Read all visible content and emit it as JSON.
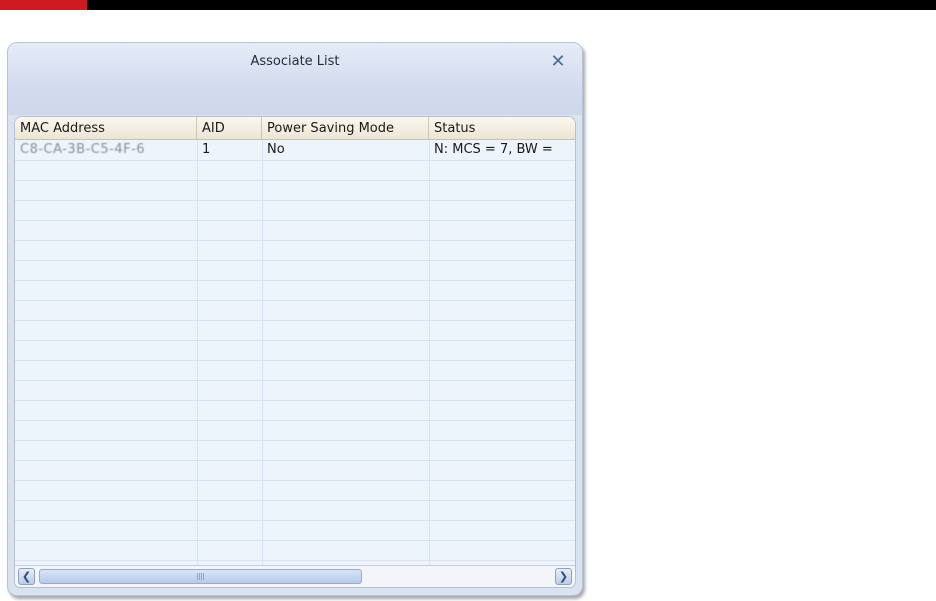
{
  "window": {
    "title": "Associate List",
    "close_symbol": "✕"
  },
  "table": {
    "columns": [
      "MAC Address",
      "AID",
      "Power Saving Mode",
      "Status"
    ],
    "rows": [
      {
        "mac": "C8-CA-3B-C5-4F-6",
        "aid": "1",
        "power_saving": "No",
        "status": "N: MCS = 7, BW ="
      }
    ]
  },
  "scrollbar": {
    "left_arrow": "❮",
    "right_arrow": "❯",
    "position_fraction": 0.0
  },
  "colors": {
    "brand_red": "#d01a22",
    "dialog_bg": "#d9e2f1",
    "row_bg": "#eef4fb"
  },
  "icons": [
    "close-icon",
    "scroll-left-arrow-icon",
    "scroll-right-arrow-icon"
  ]
}
